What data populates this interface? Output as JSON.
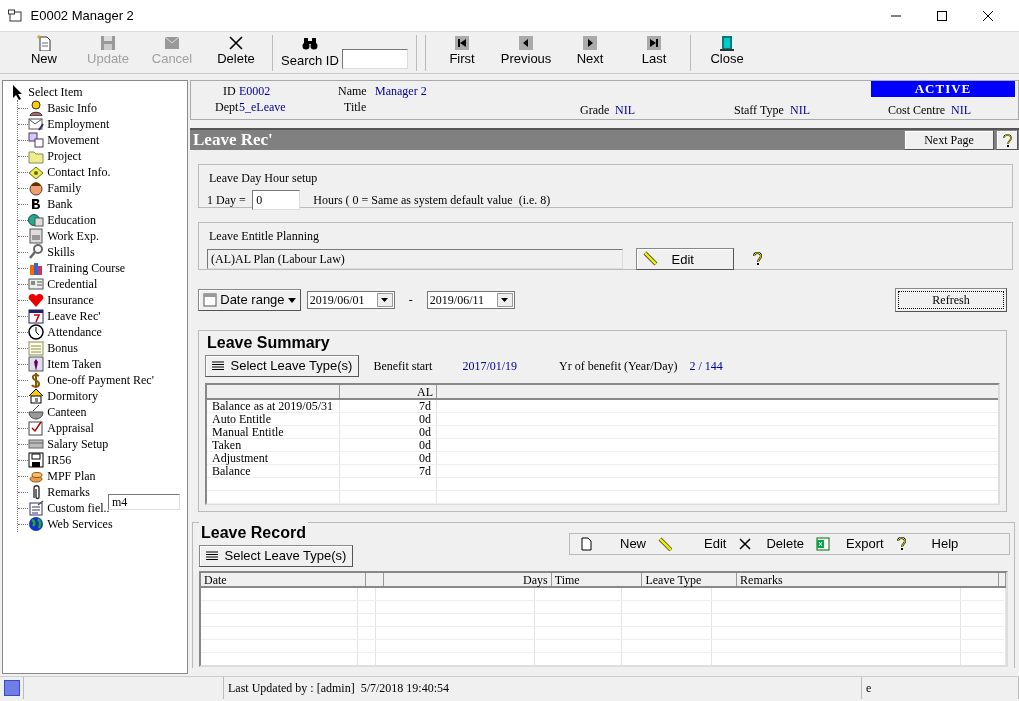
{
  "window": {
    "title": "E0002 Manager 2"
  },
  "toolbar": [
    {
      "kind": "button",
      "label": "New",
      "disabled": false
    },
    {
      "kind": "button",
      "label": "Update",
      "disabled": true
    },
    {
      "kind": "button",
      "label": "Cancel",
      "disabled": true
    },
    {
      "kind": "button",
      "label": "Delete",
      "disabled": false
    },
    {
      "kind": "search",
      "label": "Search ID"
    },
    {
      "kind": "button",
      "label": "First",
      "disabled": false
    },
    {
      "kind": "button",
      "label": "Previous",
      "disabled": false
    },
    {
      "kind": "button",
      "label": "Next",
      "disabled": false
    },
    {
      "kind": "button",
      "label": "Last",
      "disabled": false
    },
    {
      "kind": "button",
      "label": "Close",
      "disabled": false
    }
  ],
  "tree": {
    "label": "Select Item",
    "children": [
      {
        "label": "Basic Info"
      },
      {
        "label": "Employment"
      },
      {
        "label": "Movement"
      },
      {
        "label": "Project"
      },
      {
        "label": "Contact Info."
      },
      {
        "label": "Family"
      },
      {
        "label": "Bank"
      },
      {
        "label": "Education"
      },
      {
        "label": "Work Exp."
      },
      {
        "label": "Skills"
      },
      {
        "label": "Training Course"
      },
      {
        "label": "Credential"
      },
      {
        "label": "Insurance"
      },
      {
        "label": "Leave Rec'"
      },
      {
        "label": "Attendance"
      },
      {
        "label": "Bonus"
      },
      {
        "label": "Item Taken"
      },
      {
        "label": "One-off Payment Rec'"
      },
      {
        "label": "Dormitory"
      },
      {
        "label": "Canteen"
      },
      {
        "label": "Appraisal"
      },
      {
        "label": "Salary Setup"
      },
      {
        "label": "IR56"
      },
      {
        "label": "MPF Plan"
      },
      {
        "label": "Remarks"
      },
      {
        "label": "Custom fiel..",
        "edit_value": "m4"
      },
      {
        "label": "Web Services"
      }
    ]
  },
  "employee": {
    "id_label": "ID",
    "id": "E0002",
    "name_label": "Name",
    "name": "Manager 2",
    "dept_label": "Dept",
    "dept": "5_eLeave",
    "title_label": "Title",
    "grade_label": "Grade",
    "grade": "NIL",
    "staff_type_label": "Staff Type",
    "staff_type": "NIL",
    "status": "ACTIVE",
    "cost_centre_label": "Cost Centre",
    "cost_centre": "NIL"
  },
  "page": {
    "title": "Leave Rec'",
    "next_page": "Next Page"
  },
  "day_hour": {
    "legend": "Leave Day Hour setup",
    "label": "1 Day =",
    "value": "0",
    "hint": "Hours ( 0 = Same as system default value  (i.e. 8)"
  },
  "entitle": {
    "legend": "Leave Entitle Planning",
    "value": "(AL)AL Plan (Labour Law)",
    "edit": "Edit"
  },
  "date_filter": {
    "mode": "Date range",
    "from": "2019/06/01",
    "separator": "-",
    "to": "2019/06/11",
    "refresh": "Refresh"
  },
  "summary": {
    "legend": "Leave Summary",
    "select": "Select Leave Type(s)",
    "benefit_start_label": "Benefit start",
    "benefit_start": "2017/01/19",
    "yr_label": "Yr of benefit (Year/Day)",
    "yr": "2 / 144",
    "column": "AL",
    "rows": [
      {
        "label": "Balance as at 2019/05/31",
        "value": "7d"
      },
      {
        "label": "Auto Entitle",
        "value": "0d"
      },
      {
        "label": "Manual Entitle",
        "value": "0d"
      },
      {
        "label": "Taken",
        "value": "0d"
      },
      {
        "label": "Adjustment",
        "value": "0d"
      },
      {
        "label": "Balance",
        "value": "7d"
      }
    ]
  },
  "record": {
    "legend": "Leave Record",
    "select": "Select Leave Type(s)",
    "actions": [
      {
        "kind": "new",
        "label": "New"
      },
      {
        "kind": "edit",
        "label": "Edit"
      },
      {
        "kind": "delete",
        "label": "Delete"
      },
      {
        "kind": "export",
        "label": "Export"
      },
      {
        "kind": "help",
        "label": "Help"
      }
    ],
    "columns": [
      {
        "label": "Date"
      },
      {
        "kind": "blank"
      },
      {
        "label": "Days",
        "kind": "number"
      },
      {
        "label": "Time"
      },
      {
        "label": "Leave Type"
      },
      {
        "label": "Remarks"
      },
      {
        "kind": "blank"
      }
    ]
  },
  "status_bar": {
    "updated": "Last Updated by : [admin]  5/7/2018 19:40:54",
    "panel": "e"
  }
}
